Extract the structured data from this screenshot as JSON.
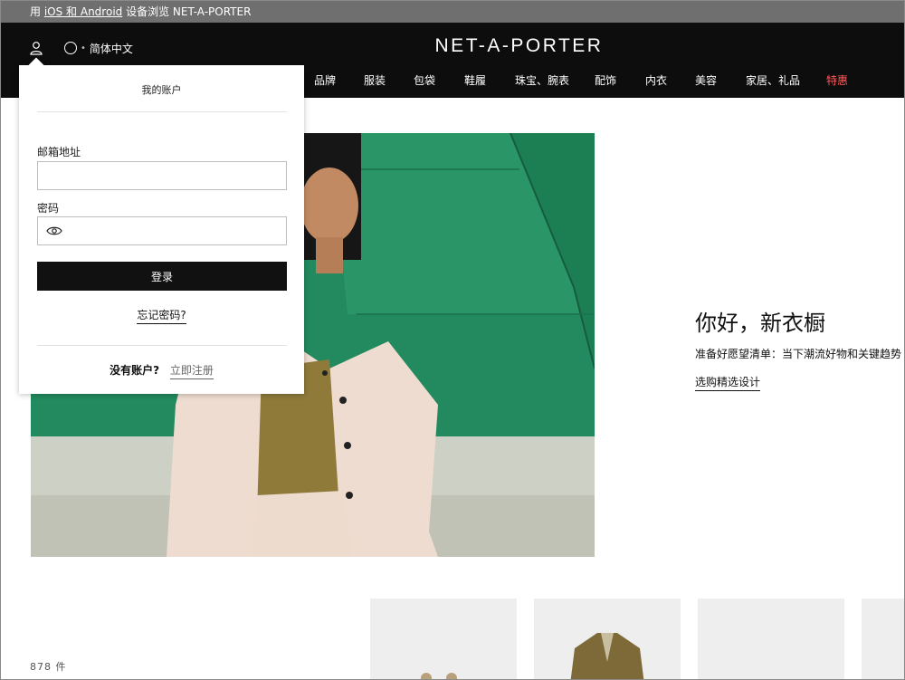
{
  "promo": {
    "prefix": "用",
    "link": "iOS 和 Android",
    "suffix": "设备浏览 NET-A-PORTER"
  },
  "header": {
    "logo": "NET-A-PORTER",
    "language": "简体中文",
    "nav": [
      {
        "label": "品牌"
      },
      {
        "label": "服装"
      },
      {
        "label": "包袋"
      },
      {
        "label": "鞋履"
      },
      {
        "label": "珠宝、腕表"
      },
      {
        "label": "配饰"
      },
      {
        "label": "内衣"
      },
      {
        "label": "美容"
      },
      {
        "label": "家居、礼品"
      },
      {
        "label": "特惠",
        "color": "#ff5a5a"
      }
    ]
  },
  "login": {
    "title": "我的账户",
    "email_label": "邮箱地址",
    "email_value": "",
    "password_label": "密码",
    "password_value": "",
    "submit": "登录",
    "forgot": "忘记密码?",
    "no_account": "没有账户?",
    "register": "立即注册"
  },
  "hero": {
    "title": "你好，新衣橱",
    "subtitle": "准备好愿望清单：当下潮流好物和关键趋势",
    "cta": "选购精选设计"
  },
  "listing": {
    "count": "878 件"
  },
  "colors": {
    "header_bg": "#0d0d0d",
    "promo_bg": "#6f6f6f",
    "sale": "#ff5a5a",
    "hero_green": "#1f8a5c"
  }
}
